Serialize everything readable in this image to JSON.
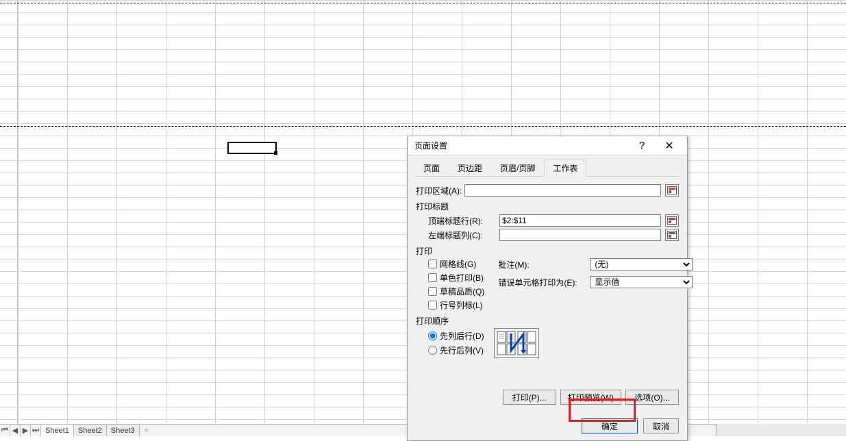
{
  "sheets": {
    "s1": "Sheet1",
    "s2": "Sheet2",
    "s3": "Sheet3"
  },
  "dialog": {
    "title": "页面设置",
    "tabs": {
      "page": "页面",
      "margins": "页边距",
      "headerfooter": "页眉/页脚",
      "sheet": "工作表"
    },
    "sheet": {
      "print_area_label": "打印区域(A):",
      "print_area_value": "",
      "titles_group": "打印标题",
      "top_rows_label": "顶端标题行(R):",
      "top_rows_value": "$2:$11",
      "left_cols_label": "左端标题列(C):",
      "left_cols_value": "",
      "print_group": "打印",
      "gridlines": "网格线(G)",
      "black_white": "单色打印(B)",
      "draft": "草稿品质(Q)",
      "row_col_headers": "行号列标(L)",
      "comments_label": "批注(M):",
      "comments_value": "(无)",
      "errors_label": "错误单元格打印为(E):",
      "errors_value": "显示值",
      "order_group": "打印顺序",
      "order_down": "先列后行(D)",
      "order_over": "先行后列(V)",
      "btn_print": "打印(P)...",
      "btn_preview": "打印预览(W)",
      "btn_options": "选项(O)..."
    },
    "ok": "确定",
    "cancel": "取消"
  }
}
